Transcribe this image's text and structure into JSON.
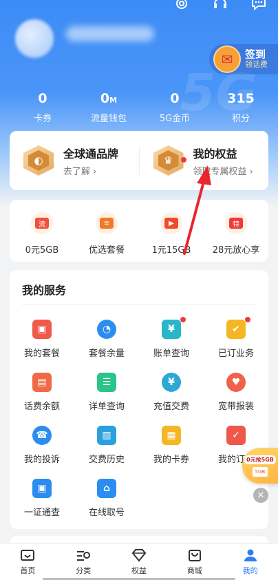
{
  "header": {
    "signin_title": "签到",
    "signin_subtitle": "领话费",
    "watermark": "5G"
  },
  "stats": [
    {
      "value": "0",
      "unit": "",
      "label": "卡券"
    },
    {
      "value": "0",
      "unit": "M",
      "label": "流量钱包"
    },
    {
      "value": "0",
      "unit": "",
      "label": "5G金币"
    },
    {
      "value": "315",
      "unit": "",
      "label": "积分"
    }
  ],
  "brand": {
    "left": {
      "title": "全球通品牌",
      "subtitle": "去了解 ›"
    },
    "right": {
      "title": "我的权益",
      "subtitle": "领取专属权益 ›"
    }
  },
  "quick": [
    {
      "label": "0元5GB",
      "glyph": "流",
      "color": "#f0503c"
    },
    {
      "label": "优选套餐",
      "glyph": "≋",
      "color": "#f07a2a"
    },
    {
      "label": "1元15GB",
      "glyph": "▶",
      "color": "#f04a2a"
    },
    {
      "label": "28元放心享",
      "glyph": "特",
      "color": "#f03a3a"
    }
  ],
  "services": {
    "title": "我的服务",
    "items": [
      {
        "label": "我的套餐",
        "glyph": "▣",
        "color": "#f05a4a"
      },
      {
        "label": "套餐余量",
        "glyph": "◔",
        "color": "#2b8df0"
      },
      {
        "label": "账单查询",
        "glyph": "¥",
        "color": "#2bb5c9"
      },
      {
        "label": "已订业务",
        "glyph": "✔",
        "color": "#f5b623"
      },
      {
        "label": "话费余额",
        "glyph": "▤",
        "color": "#f06a4a"
      },
      {
        "label": "详单查询",
        "glyph": "☰",
        "color": "#2bc48a"
      },
      {
        "label": "充值交费",
        "glyph": "¥",
        "color": "#2ba8d6"
      },
      {
        "label": "宽带报装",
        "glyph": "♥",
        "color": "#f0614a"
      },
      {
        "label": "我的投诉",
        "glyph": "☎",
        "color": "#2b8df0"
      },
      {
        "label": "交费历史",
        "glyph": "▥",
        "color": "#2ba0e0"
      },
      {
        "label": "我的卡券",
        "glyph": "▦",
        "color": "#f5b623"
      },
      {
        "label": "我的订单",
        "glyph": "✓",
        "color": "#f0564a"
      },
      {
        "label": "一证通查",
        "glyph": "▣",
        "color": "#2b8df0"
      },
      {
        "label": "在线取号",
        "glyph": "⌂",
        "color": "#2b8df0"
      }
    ]
  },
  "float": {
    "promo_text": "0元抢5GB",
    "card_text": "5GB",
    "close": "✕"
  },
  "tabs": [
    {
      "label": "首页"
    },
    {
      "label": "分类"
    },
    {
      "label": "权益"
    },
    {
      "label": "商城"
    },
    {
      "label": "我的"
    }
  ],
  "colors": {
    "primary": "#2f7df5",
    "hero_top": "#3c8bf6",
    "arrow": "#e8262e",
    "badge": "#f03a3a"
  }
}
